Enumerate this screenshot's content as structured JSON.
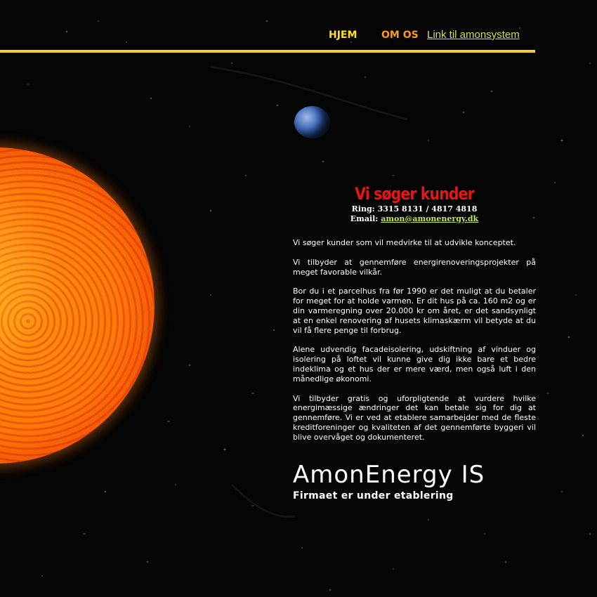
{
  "nav": {
    "items": [
      {
        "label": "HJEM",
        "color": "#ffe21a"
      },
      {
        "label": "OM OS",
        "color": "#ff9a18"
      }
    ],
    "link_label": "Link til amonsystem",
    "rule_color": "#f2cf2c"
  },
  "main": {
    "headline": "Vi søger kunder",
    "phone_label": "Ring:",
    "phone_value": "3315 8131 / 4817 4818",
    "email_label": "Email:",
    "email_value": "amon@amonenergy.dk",
    "paragraphs": [
      "Vi søger kunder som vil medvirke til at udvikle konceptet.",
      "Vi tilbyder at gennemføre energirenoveringsprojekter på meget favorable vilkår.",
      "Bor du i et parcelhus fra før 1990 er det muligt at du betaler for meget for at holde varmen. Er dit hus på ca. 160 m2 og er din varmeregning over 20.000 kr om året, er det sandsynligt at en enkel renovering af husets klimaskærm vil betyde at du vil få flere penge til forbrug.",
      "Alene udvendig facadeisolering, udskiftning af vinduer og isolering på loftet vil kunne give dig ikke bare et bedre indeklima og et hus der er mere værd, men også luft i den månedlige økonomi.",
      "Vi tilbyder gratis og uforpligtende at vurdere hvilke energimæssige ændringer det kan betale sig for dig at gennemføre. Vi er ved at etablere samarbejder med de fleste kreditforeninger og kvaliteten af det gennemførte byggeri vil blive overvåget og dokumenteret."
    ],
    "company_name": "AmonEnergy IS",
    "tagline": "Firmaet er under etablering"
  },
  "colors": {
    "background": "#050505",
    "headline": "#ea1414",
    "link": "#c8e64c",
    "text": "#ffffff"
  }
}
